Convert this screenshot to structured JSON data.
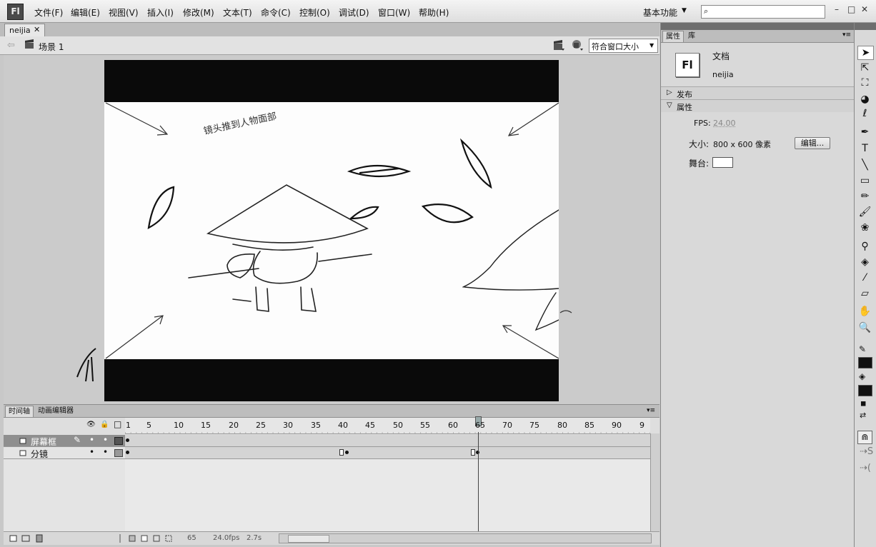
{
  "app": {
    "logo": "Fl"
  },
  "menu": [
    "文件(F)",
    "编辑(E)",
    "视图(V)",
    "插入(I)",
    "修改(M)",
    "文本(T)",
    "命令(C)",
    "控制(O)",
    "调试(D)",
    "窗口(W)",
    "帮助(H)"
  ],
  "workspace": {
    "label": "基本功能",
    "arrow": "▼"
  },
  "search": {
    "placeholder": "",
    "icon": "⌕"
  },
  "window_controls": {
    "minimize": "–",
    "maximize": "□",
    "close": "✕"
  },
  "document_tab": {
    "label": "neijia",
    "close": "✕"
  },
  "scene_bar": {
    "back": "⇦",
    "scene_label": "场景 1",
    "zoom": "符合窗口大小",
    "zoom_arrow": "▼"
  },
  "stage": {
    "annotation": "镜头推到人物面部",
    "letterbox_color": "#0a0a0a",
    "canvas_color": "#ffffff"
  },
  "timeline": {
    "tabs": [
      "时间轴",
      "动画编辑器"
    ],
    "menu_icon": "▾≡",
    "header_icons": [
      "👁",
      "🔒",
      "□"
    ],
    "ruler_ticks": [
      "1",
      "5",
      "10",
      "15",
      "20",
      "25",
      "30",
      "35",
      "40",
      "45",
      "50",
      "55",
      "60",
      "65",
      "70",
      "75",
      "80",
      "85",
      "90",
      "9"
    ],
    "playhead_frame": 65,
    "layers": [
      {
        "name": "屏幕框",
        "selected": true,
        "pencil": "✎",
        "dot1": "•",
        "dot2": "•"
      },
      {
        "name": "分镜",
        "selected": false,
        "dot1": "•",
        "dot2": "•"
      }
    ],
    "status": {
      "current_frame": "65",
      "fps": "24.0fps",
      "time": "2.7s"
    }
  },
  "properties": {
    "tabs": [
      "属性",
      "库"
    ],
    "menu_icon": "▾≡",
    "doc_icon": "Fl",
    "doc_type": "文档",
    "doc_name": "neijia",
    "publish": {
      "arrow": "▷",
      "label": "发布"
    },
    "props_section": {
      "arrow": "▽",
      "label": "属性"
    },
    "fps_label": "FPS:",
    "fps_value": "24.00",
    "size_label": "大小:",
    "size_value": "800 x 600 像素",
    "edit_button": "编辑...",
    "stage_label": "舞台:",
    "stage_color": "#ffffff"
  },
  "tools": [
    {
      "name": "selection-tool-icon",
      "glyph": "➤"
    },
    {
      "name": "subselection-tool-icon",
      "glyph": "⇱"
    },
    {
      "name": "free-transform-tool-icon",
      "glyph": "⛶"
    },
    {
      "name": "3d-rotation-tool-icon",
      "glyph": "◕"
    },
    {
      "name": "lasso-tool-icon",
      "glyph": "ℓ"
    },
    {
      "name": "pen-tool-icon",
      "glyph": "✒"
    },
    {
      "name": "text-tool-icon",
      "glyph": "T"
    },
    {
      "name": "line-tool-icon",
      "glyph": "╲"
    },
    {
      "name": "rectangle-tool-icon",
      "glyph": "▭"
    },
    {
      "name": "pencil-tool-icon",
      "glyph": "✏"
    },
    {
      "name": "brush-tool-icon",
      "glyph": "🖌"
    },
    {
      "name": "deco-tool-icon",
      "glyph": "❀"
    },
    {
      "name": "bone-tool-icon",
      "glyph": "⚲"
    },
    {
      "name": "paint-bucket-tool-icon",
      "glyph": "◈"
    },
    {
      "name": "eyedropper-tool-icon",
      "glyph": "⁄"
    },
    {
      "name": "eraser-tool-icon",
      "glyph": "▱"
    },
    {
      "name": "hand-tool-icon",
      "glyph": "✋"
    },
    {
      "name": "zoom-tool-icon",
      "glyph": "🔍"
    }
  ],
  "tool_colors": {
    "stroke": "#111111",
    "fill": "#111111"
  }
}
